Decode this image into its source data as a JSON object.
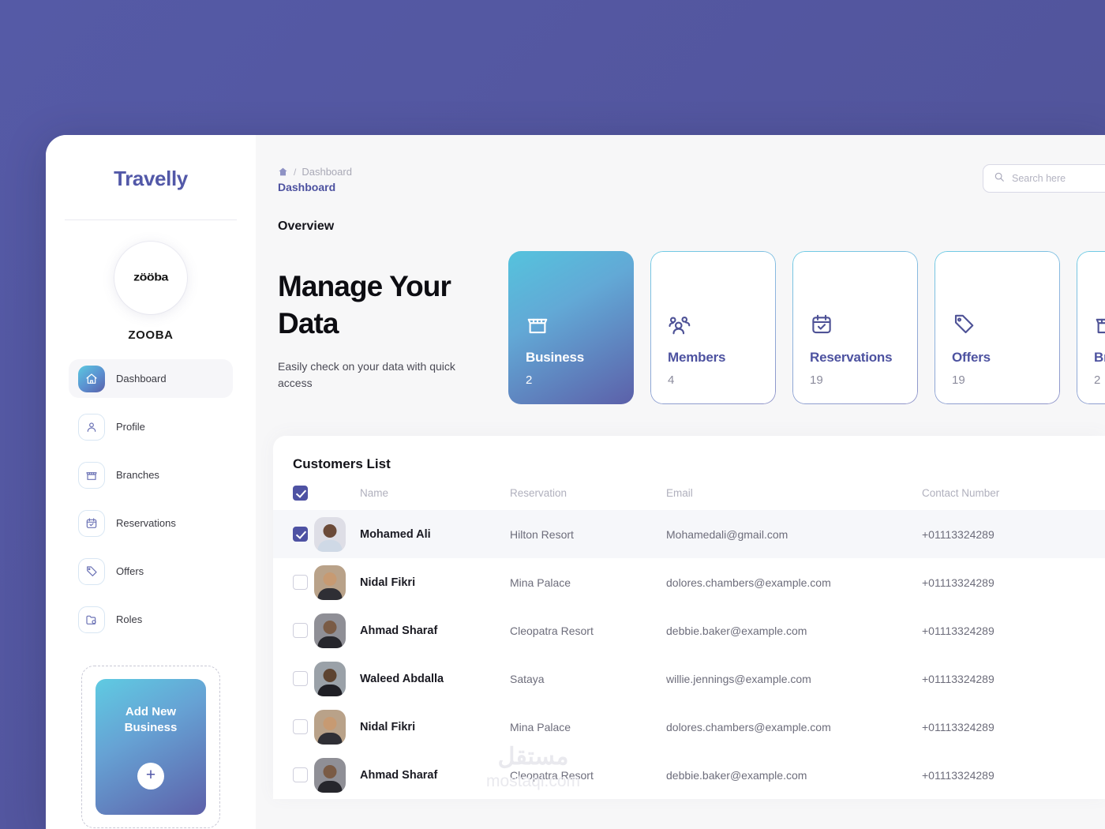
{
  "theme": {
    "bg_purple": "#53569f",
    "accent_indigo": "#4d52a0",
    "accent_cyan": "#55c3dd",
    "panel_bg": "#f7f7f8"
  },
  "sidebar": {
    "brand": "Travelly",
    "logo_text": "zööba",
    "business_name": "ZOOBA",
    "items": [
      {
        "label": "Dashboard",
        "icon": "home-icon",
        "active": true
      },
      {
        "label": "Profile",
        "icon": "user-icon",
        "active": false
      },
      {
        "label": "Branches",
        "icon": "store-icon",
        "active": false
      },
      {
        "label": "Reservations",
        "icon": "calendar-icon",
        "active": false
      },
      {
        "label": "Offers",
        "icon": "tag-icon",
        "active": false
      },
      {
        "label": "Roles",
        "icon": "folder-lock-icon",
        "active": false
      }
    ],
    "add_business": {
      "line1": "Add New",
      "line2": "Business",
      "plus": "+"
    }
  },
  "header": {
    "breadcrumb_home_icon": "home-icon",
    "breadcrumb_separator": "/",
    "breadcrumb_parent": "Dashboard",
    "page_title": "Dashboard"
  },
  "search": {
    "icon": "search-icon",
    "placeholder": "Search here",
    "value": ""
  },
  "overview": {
    "section_title": "Overview",
    "hero_line1": "Manage Your",
    "hero_line2": "Data",
    "hero_subtitle": "Easily check on your data with quick access"
  },
  "stat_cards": [
    {
      "label": "Business",
      "value": "2",
      "icon": "store-icon",
      "active": true
    },
    {
      "label": "Members",
      "value": "4",
      "icon": "members-icon",
      "active": false
    },
    {
      "label": "Reservations",
      "value": "19",
      "icon": "calendar-check-icon",
      "active": false
    },
    {
      "label": "Offers",
      "value": "19",
      "icon": "tag-icon",
      "active": false
    },
    {
      "label": "Branches",
      "value": "2",
      "icon": "store-icon",
      "active": false
    }
  ],
  "table": {
    "title": "Customers List",
    "select_all_checked": true,
    "columns": [
      "Name",
      "Reservation",
      "Email",
      "Contact Number"
    ],
    "rows": [
      {
        "checked": true,
        "name": "Mohamed Ali",
        "reservation": "Hilton Resort",
        "email": "Mohamedali@gmail.com",
        "contact": "+01113324289",
        "avatar_skin": "#6b4a38",
        "avatar_shirt": "#cfd9e6",
        "avatar_bg": "#dedee6"
      },
      {
        "checked": false,
        "name": "Nidal Fikri",
        "reservation": "Mina Palace",
        "email": "dolores.chambers@example.com",
        "contact": "+01113324289",
        "avatar_skin": "#c79a72",
        "avatar_shirt": "#2f2f35",
        "avatar_bg": "#b9a289"
      },
      {
        "checked": false,
        "name": "Ahmad Sharaf",
        "reservation": "Cleopatra Resort",
        "email": "debbie.baker@example.com",
        "contact": "+01113324289",
        "avatar_skin": "#7a5b45",
        "avatar_shirt": "#26262c",
        "avatar_bg": "#8f8f96"
      },
      {
        "checked": false,
        "name": "Waleed Abdalla",
        "reservation": "Sataya",
        "email": "willie.jennings@example.com",
        "contact": "+01113324289",
        "avatar_skin": "#5d4330",
        "avatar_shirt": "#1f1f25",
        "avatar_bg": "#9aa1a8"
      },
      {
        "checked": false,
        "name": "Nidal Fikri",
        "reservation": "Mina Palace",
        "email": "dolores.chambers@example.com",
        "contact": "+01113324289",
        "avatar_skin": "#c79a72",
        "avatar_shirt": "#2f2f35",
        "avatar_bg": "#b9a289"
      },
      {
        "checked": false,
        "name": "Ahmad Sharaf",
        "reservation": "Cleopatra Resort",
        "email": "debbie.baker@example.com",
        "contact": "+01113324289",
        "avatar_skin": "#7a5b45",
        "avatar_shirt": "#26262c",
        "avatar_bg": "#8f8f96"
      }
    ]
  },
  "watermark": {
    "arabic": "مستقل",
    "latin": "mostaql.com"
  }
}
